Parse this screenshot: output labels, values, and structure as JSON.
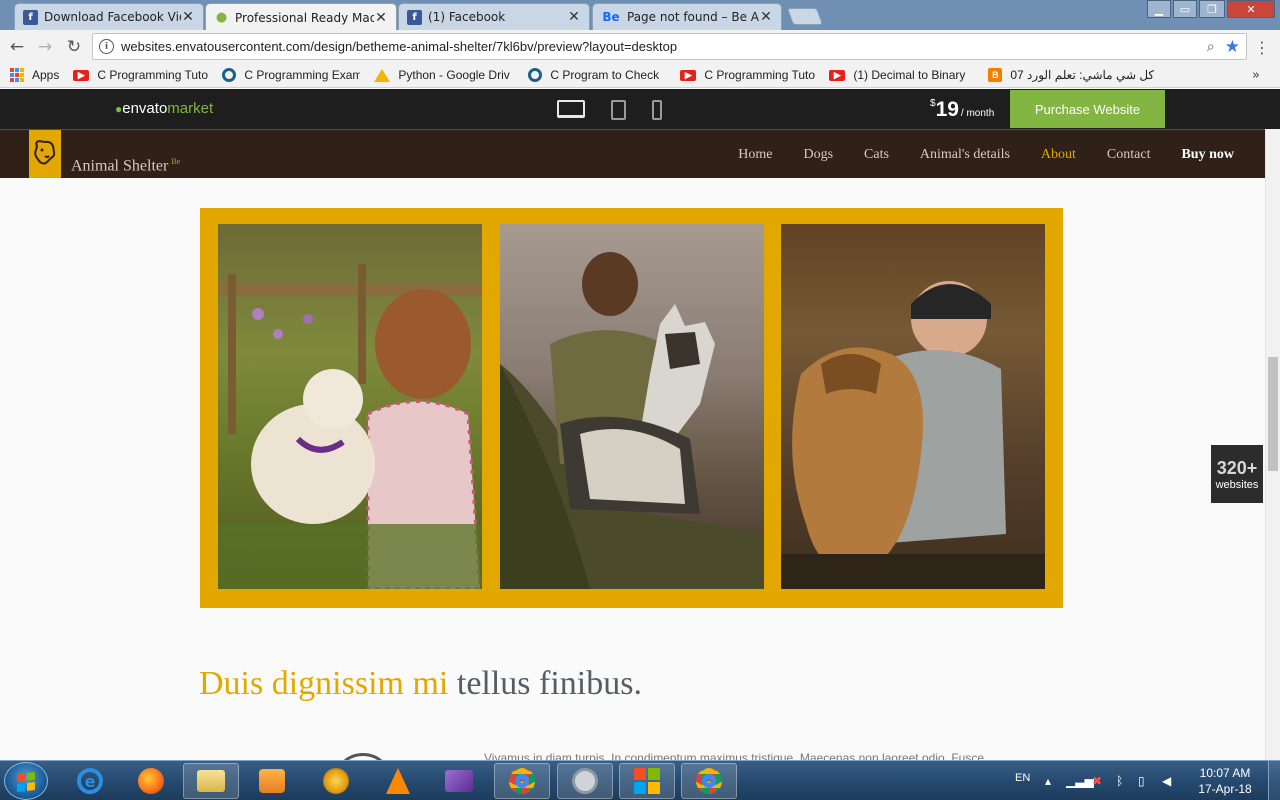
{
  "browser": {
    "tabs": [
      {
        "title": "Download Facebook Vid",
        "icon": "facebook-icon",
        "color": "#3b5998",
        "active": false
      },
      {
        "title": "Professional Ready Made",
        "icon": "envato-leaf-icon",
        "color": "#82b541",
        "active": true
      },
      {
        "title": "(1) Facebook",
        "icon": "facebook-icon",
        "color": "#3b5998",
        "active": false
      },
      {
        "title": "Page not found – Be Ani",
        "icon": "behance-icon",
        "color": "#1769ff",
        "active": false
      }
    ],
    "favicon_letters": {
      "facebook": "f",
      "behance": "Be"
    },
    "url": "websites.envatousercontent.com/design/betheme-animal-shelter/7kl6bv/preview?layout=desktop",
    "bookmarks": [
      {
        "label": "Apps",
        "icon": "apps-grid-icon"
      },
      {
        "label": "C Programming Tuto",
        "icon": "youtube-icon",
        "color": "#e62117"
      },
      {
        "label": "C Programming Exam",
        "icon": "c-site-icon",
        "color": "#1c5f8b"
      },
      {
        "label": "Python - Google Driv",
        "icon": "google-drive-icon",
        "color": "#f4b400"
      },
      {
        "label": "C Program to Check",
        "icon": "c-site-icon",
        "color": "#1c5f8b"
      },
      {
        "label": "C Programming Tuto",
        "icon": "youtube-icon",
        "color": "#e62117"
      },
      {
        "label": "(1) Decimal to Binary",
        "icon": "youtube-icon",
        "color": "#e62117"
      },
      {
        "label": "كل شي ماشي: تعلم الورد 07",
        "icon": "blogger-icon",
        "color": "#f57d00"
      }
    ],
    "more_label": "»"
  },
  "envato": {
    "logo_text": "envato",
    "logo_market": "market",
    "price_currency": "$",
    "price_amount": "19",
    "price_period": "/ month",
    "purchase_label": "Purchase Website"
  },
  "site": {
    "name": "Animal Shelter",
    "name_sup": "Be",
    "nav": [
      {
        "label": "Home",
        "state": "normal"
      },
      {
        "label": "Dogs",
        "state": "normal"
      },
      {
        "label": "Cats",
        "state": "normal"
      },
      {
        "label": "Animal's details",
        "state": "normal"
      },
      {
        "label": "About",
        "state": "active"
      },
      {
        "label": "Contact",
        "state": "normal"
      },
      {
        "label": "Buy now",
        "state": "buy"
      }
    ],
    "accent_color": "#e3a800",
    "header_color": "#2f2118"
  },
  "content": {
    "headline_accent": "Duis dignissim mi",
    "headline_rest": " tellus finibus.",
    "body_snippet": "Vivamus in diam turpis. In condimentum maximus tristique. Maecenas non laoreet odio. Fusce"
  },
  "badge": {
    "count": "320+",
    "label": "websites"
  },
  "taskbar": {
    "language": "EN",
    "time": "10:07 AM",
    "date": "17-Apr-18",
    "apps": [
      "internet-explorer-icon",
      "firefox-icon",
      "file-explorer-icon",
      "media-player-icon",
      "aimp-icon",
      "vlc-icon",
      "visual-studio-icon",
      "chrome-icon",
      "settings-app-icon",
      "office-icon",
      "chrome-icon"
    ]
  }
}
